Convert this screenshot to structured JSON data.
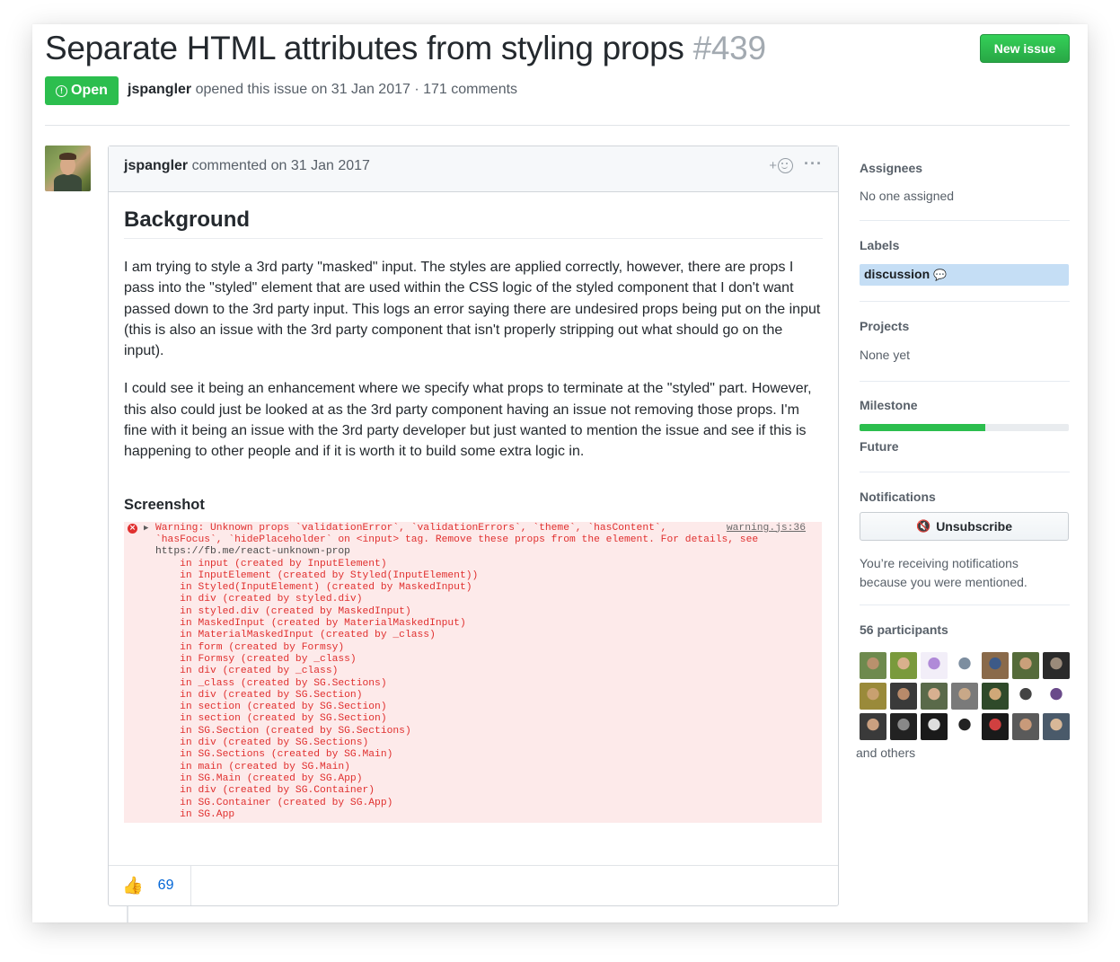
{
  "issue": {
    "title": "Separate HTML attributes from styling props",
    "number": "#439",
    "state": "Open",
    "author": "jspangler",
    "meta_text": " opened this issue on 31 Jan 2017 · 171 comments",
    "new_issue_label": "New issue"
  },
  "comment": {
    "author": "jspangler",
    "header_text": " commented on 31 Jan 2017",
    "add_reaction": "+",
    "more_label": "···",
    "heading": "Background",
    "para1": "I am trying to style a 3rd party \"masked\" input. The styles are applied correctly, however, there are props I pass into the \"styled\" element that are used within the CSS logic of the styled component that I don't want passed down to the 3rd party input. This logs an error saying there are undesired props being put on the input (this is also an issue with the 3rd party component that isn't properly stripping out what should go on the input).",
    "para2": "I could see it being an enhancement where we specify what props to terminate at the \"styled\" part. However, this also could just be looked at as the 3rd party component having an issue not removing those props. I'm fine with it being an issue with the 3rd party developer but just wanted to mention the issue and see if this is happening to other people and if it is worth it to build some extra logic in.",
    "screenshot_heading": "Screenshot",
    "reaction_emoji": "👍",
    "reaction_count": "69"
  },
  "console": {
    "source": "warning.js:36",
    "error_icon": "×",
    "expand_icon": "▶",
    "lines": [
      "Warning: Unknown props `validationError`, `validationErrors`, `theme`, `hasContent`,",
      "`hasFocus`, `hidePlaceholder` on <input> tag. Remove these props from the element. For details, see",
      "https://fb.me/react-unknown-prop",
      "    in input (created by InputElement)",
      "    in InputElement (created by Styled(InputElement))",
      "    in Styled(InputElement) (created by MaskedInput)",
      "    in div (created by styled.div)",
      "    in styled.div (created by MaskedInput)",
      "    in MaskedInput (created by MaterialMaskedInput)",
      "    in MaterialMaskedInput (created by _class)",
      "    in form (created by Formsy)",
      "    in Formsy (created by _class)",
      "    in div (created by _class)",
      "    in _class (created by SG.Sections)",
      "    in div (created by SG.Section)",
      "    in section (created by SG.Section)",
      "    in section (created by SG.Section)",
      "    in SG.Section (created by SG.Sections)",
      "    in div (created by SG.Sections)",
      "    in SG.Sections (created by SG.Main)",
      "    in main (created by SG.Main)",
      "    in SG.Main (created by SG.App)",
      "    in div (created by SG.Container)",
      "    in SG.Container (created by SG.App)",
      "    in SG.App"
    ]
  },
  "sidebar": {
    "assignees_heading": "Assignees",
    "assignees_value": "No one assigned",
    "labels_heading": "Labels",
    "label_name": "discussion",
    "label_color": "#c5def5",
    "projects_heading": "Projects",
    "projects_value": "None yet",
    "milestone_heading": "Milestone",
    "milestone_progress": 0.6,
    "milestone_value": "Future",
    "notifications_heading": "Notifications",
    "unsubscribe_label": "Unsubscribe",
    "unsubscribe_icon": "🔇",
    "notifications_reason_1": "You’re receiving notifications",
    "notifications_reason_2": "because you were mentioned.",
    "participants_heading": "56 participants",
    "and_others": "and others"
  },
  "colors": {
    "open_green": "#2cbe4e",
    "link_blue": "#0366d6",
    "console_red": "#e0302f",
    "console_bg": "#fdeaea"
  }
}
